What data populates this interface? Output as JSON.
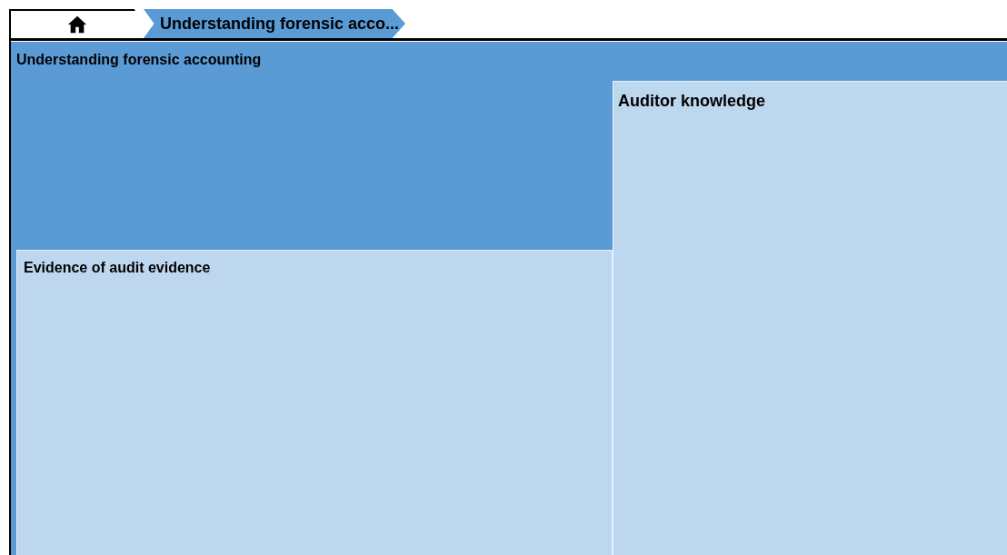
{
  "breadcrumbs": [
    {
      "kind": "home",
      "selected": false
    },
    {
      "kind": "text",
      "label": "Understanding forensic acco...",
      "selected": true
    }
  ],
  "treemap": {
    "title": "Understanding forensic accounting",
    "children": [
      {
        "title": "Auditor knowledge"
      },
      {
        "title": "Evidence of audit evidence"
      }
    ]
  }
}
